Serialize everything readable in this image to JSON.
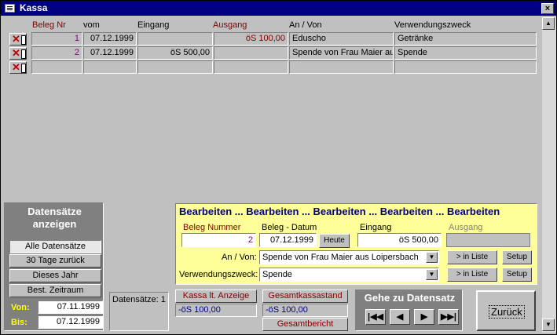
{
  "window": {
    "title": "Kassa",
    "close_label": "×"
  },
  "columns": {
    "beleg_nr": "Beleg Nr",
    "vom": "vom",
    "eingang": "Eingang",
    "ausgang": "Ausgang",
    "an_von": "An / Von",
    "verwendungszweck": "Verwendungszweck"
  },
  "rows": [
    {
      "beleg_nr": "1",
      "vom": "07.12.1999",
      "eingang": "",
      "ausgang": "öS 100,00",
      "an_von": "Eduscho",
      "verwendungszweck": "Getränke"
    },
    {
      "beleg_nr": "2",
      "vom": "07.12.1999",
      "eingang": "öS 500,00",
      "ausgang": "",
      "an_von": "Spende von Frau Maier au",
      "verwendungszweck": "Spende"
    },
    {
      "beleg_nr": "",
      "vom": "",
      "eingang": "",
      "ausgang": "",
      "an_von": "",
      "verwendungszweck": ""
    }
  ],
  "filter": {
    "title": "Datensätze anzeigen",
    "buttons": [
      "Alle Datensätze",
      "30 Tage zurück",
      "Dieses Jahr",
      "Best. Zeitraum"
    ],
    "von_label": "Von:",
    "von_value": "07.11.1999",
    "bis_label": "Bis:",
    "bis_value": "07.12.1999"
  },
  "record_count": "Datensätze: 1",
  "edit": {
    "marquee": "Bearbeiten ... Bearbeiten ... Bearbeiten ... Bearbeiten ... Bearbeiten",
    "beleg_nummer_label": "Beleg Nummer",
    "beleg_nummer_value": "2",
    "beleg_datum_label": "Beleg - Datum",
    "beleg_datum_value": "07.12.1999",
    "heute_label": "Heute",
    "eingang_label": "Eingang",
    "eingang_value": "öS 500,00",
    "ausgang_label": "Ausgang",
    "ausgang_value": "",
    "an_von_label": "An / Von:",
    "an_von_value": "Spende von Frau Maier aus Loipersbach",
    "zweck_label": "Verwendungszweck:",
    "zweck_value": "Spende",
    "in_liste_label": "> in Liste",
    "setup_label": "Setup"
  },
  "totals": {
    "kassa_label": "Kassa lt. Anzeige",
    "kassa_value": "-öS 100,00",
    "gesamt_label": "Gesamtkassastand",
    "gesamt_value": "-öS 100,00",
    "bericht_label": "Gesamtbericht"
  },
  "nav": {
    "title": "Gehe zu Datensatz",
    "first": "|◀◀",
    "prev": "◀",
    "next": "▶",
    "last": "▶▶|"
  },
  "zurueck_label": "Zurück",
  "colors": {
    "title_bar": "#000080",
    "edit_panel": "#ffff99",
    "accent_red": "#800000",
    "yellow_label": "#ffff00"
  }
}
